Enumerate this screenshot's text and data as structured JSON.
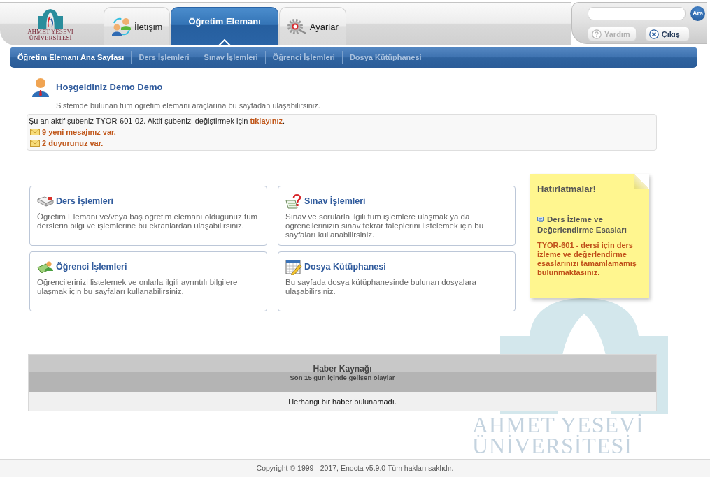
{
  "header": {
    "logo": {
      "lines": [
        "AHMET YESEVİ",
        "ÜNİVERSİTESİ"
      ]
    },
    "tabs": [
      {
        "label": "İletişim",
        "selected": false
      },
      {
        "label": "Öğretim Elemanı",
        "selected": true
      },
      {
        "label": "Ayarlar",
        "selected": false
      }
    ],
    "search": {
      "button": "Ara"
    },
    "buttons": [
      {
        "label": "Yardım",
        "disabled": true
      },
      {
        "label": "Çıkış",
        "disabled": false
      }
    ]
  },
  "subnav": {
    "items": [
      {
        "label": "Öğretim Elemanı Ana Sayfası",
        "selected": true
      },
      {
        "label": "Ders İşlemleri",
        "selected": false
      },
      {
        "label": "Sınav İşlemleri",
        "selected": false
      },
      {
        "label": "Öğrenci İşlemleri",
        "selected": false
      },
      {
        "label": "Dosya Kütüphanesi",
        "selected": false
      }
    ]
  },
  "welcome": {
    "title": "Hoşgeldiniz Demo Demo",
    "subtitle": "Sistemde bulunan tüm öğretim elemanı araçlarına bu sayfadan ulaşabilirsiniz."
  },
  "notice": {
    "text": "Şu an aktif şubeniz TYOR-601-02. Aktif şubenizi değiştirmek için",
    "link": "tıklayınız",
    "after": ".",
    "alerts": [
      {
        "text": "9 yeni mesajınız var."
      },
      {
        "text": "2 duyurunuz var."
      }
    ]
  },
  "cards": [
    {
      "title": "Ders İşlemleri",
      "description": "Öğretim Elemanı ve/veya baş öğretim elemanı olduğunuz tüm derslerin bilgi ve işlemlerine bu ekranlardan ulaşabilirsiniz."
    },
    {
      "title": "Sınav İşlemleri",
      "description": "Sınav ve sorularla ilgili tüm işlemlere ulaşmak ya da öğrencilerinizin sınav tekrar taleplerini listelemek için bu sayfaları kullanabilirsiniz."
    },
    {
      "title": "Öğrenci İşlemleri",
      "description": "Öğrencilerinizi listelemek ve onlarla ilgili ayrıntılı bilgilere ulaşmak için bu sayfaları kullanabilirsiniz."
    },
    {
      "title": "Dosya Kütüphanesi",
      "description": "Bu sayfada dosya kütüphanesinde bulunan dosyalara ulaşabilirsiniz."
    }
  ],
  "reminders": {
    "title": "Hatırlatmalar!",
    "link": "Ders İzleme ve Değerlendirme Esasları",
    "warning": "TYOR-601 - dersi için ders izleme ve değerlendirme esaslarınızı tamamlamamış bulunmaktasınız."
  },
  "news": {
    "title": "Haber Kaynağı",
    "subtitle": "Son 15 gün içinde gelişen olaylar",
    "empty_message": "Herhangi bir haber bulunamadı."
  },
  "background_logo": {
    "lines": [
      "AHMET YESEVİ",
      "ÜNİVERSİTESİ"
    ]
  },
  "footer": {
    "copyright": "Copyright © 1999 - 2017, Enocta v5.9.0 Tüm hakları saklıdır."
  }
}
